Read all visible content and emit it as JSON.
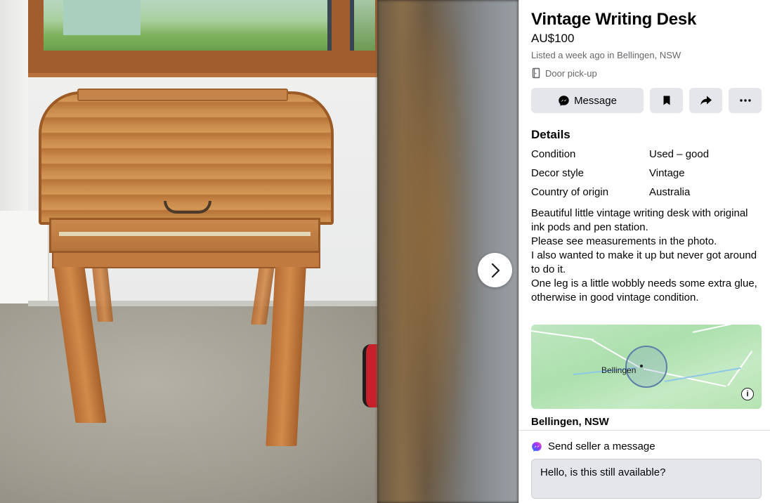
{
  "listing": {
    "title": "Vintage Writing Desk",
    "price": "AU$100",
    "listed": "Listed a week ago in Bellingen, NSW",
    "pickup": "Door pick-up"
  },
  "actions": {
    "message_label": "Message",
    "save_icon": "bookmark-icon",
    "share_icon": "share-icon",
    "more_icon": "more-icon"
  },
  "details": {
    "heading": "Details",
    "rows": [
      {
        "key": "Condition",
        "value": "Used – good"
      },
      {
        "key": "Decor style",
        "value": "Vintage"
      },
      {
        "key": "Country of origin",
        "value": "Australia"
      }
    ],
    "description": [
      "Beautiful little vintage writing desk with original ink pods and pen station.",
      "Please see measurements in the photo.",
      "I also wanted to make it up but never got around to do it.",
      "One leg is a little wobbly needs some extra glue, otherwise in good vintage condition."
    ]
  },
  "map": {
    "label": "Bellingen",
    "location": "Bellingen, NSW"
  },
  "composer": {
    "label": "Send seller a message",
    "input_value": "Hello, is this still available?"
  },
  "colors": {
    "button_bg": "#e4e6eb",
    "secondary_text": "#65676b",
    "map_green": "#b6e4b2"
  }
}
